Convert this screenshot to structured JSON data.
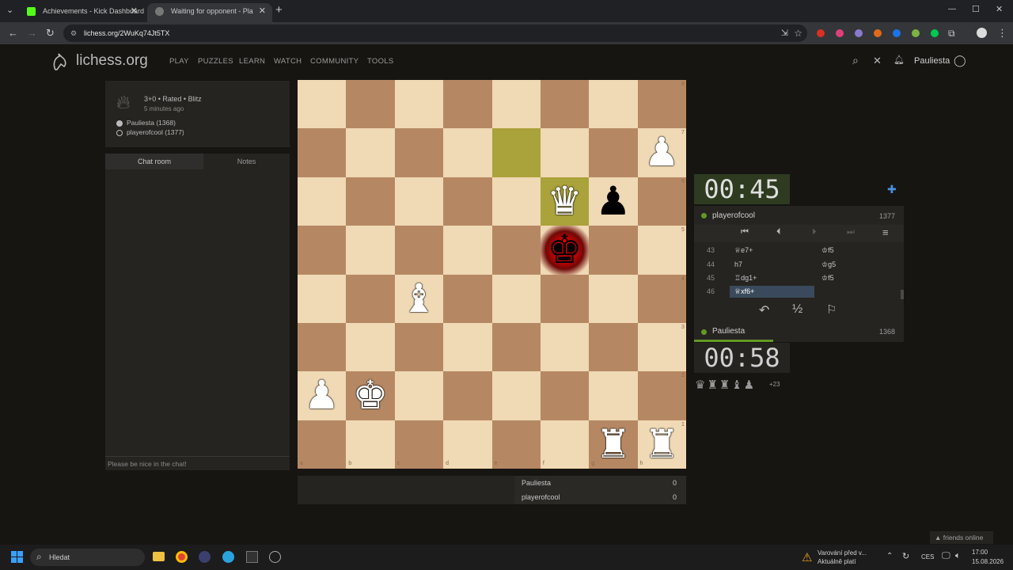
{
  "browser": {
    "tabs": [
      {
        "title": "Achievements - Kick Dashboard",
        "icon_color": "#53fc18",
        "active": false
      },
      {
        "title": "Waiting for opponent - Pla",
        "icon_color": "#888888",
        "active": true
      }
    ],
    "url": "lichess.org/2WuKq74Jt5TX",
    "icons": {
      "back": "←",
      "forward": "→",
      "reload": "↻",
      "new_tab": "+",
      "minimize": "—",
      "maximize": "☐",
      "close": "✕",
      "star": "☆",
      "menu": "⋮",
      "tab_close": "✕",
      "tab_menu": "⌄",
      "profile": "●",
      "extensions": "⧉"
    }
  },
  "site": {
    "logo_text": "lichess.org",
    "nav": [
      "PLAY",
      "PUZZLES",
      "LEARN",
      "WATCH",
      "COMMUNITY",
      "TOOLS"
    ],
    "username": "Pauliesta",
    "icons": {
      "search": "⌕",
      "close": "✕",
      "bell": "🔔︎",
      "user": "◯"
    }
  },
  "game": {
    "info": "3+0 • Rated • Blitz",
    "time_ago": "5 minutes ago",
    "white_player": "Pauliesta (1368)",
    "black_player": "playerofcool (1377)"
  },
  "chat": {
    "tab_chat": "Chat room",
    "tab_notes": "Notes",
    "placeholder": "Please be nice in the chat!"
  },
  "board": {
    "files": [
      "a",
      "b",
      "c",
      "d",
      "e",
      "f",
      "g",
      "h"
    ],
    "ranks": [
      "8",
      "7",
      "6",
      "5",
      "4",
      "3",
      "2",
      "1"
    ],
    "last_move": [
      "e7",
      "f6"
    ],
    "check": "f5",
    "pieces": [
      {
        "sq": "h7",
        "glyph": "♟",
        "color": "white"
      },
      {
        "sq": "f6",
        "glyph": "♛",
        "color": "white"
      },
      {
        "sq": "g6",
        "glyph": "♟",
        "color": "black"
      },
      {
        "sq": "f5",
        "glyph": "♚",
        "color": "black"
      },
      {
        "sq": "c4",
        "glyph": "♝",
        "color": "white"
      },
      {
        "sq": "a2",
        "glyph": "♟",
        "color": "white"
      },
      {
        "sq": "b2",
        "glyph": "♚",
        "color": "white"
      },
      {
        "sq": "g1",
        "glyph": "♜",
        "color": "white"
      },
      {
        "sq": "h1",
        "glyph": "♜",
        "color": "white"
      }
    ]
  },
  "score": {
    "p1": "Pauliesta",
    "s1": "0",
    "p2": "playerofcool",
    "s2": "0"
  },
  "clock": {
    "top": "00:45",
    "bottom": "00:58"
  },
  "opponent": {
    "name": "playerofcool",
    "rating": "1377"
  },
  "me": {
    "name": "Pauliesta",
    "rating": "1368"
  },
  "moves": [
    {
      "n": "43",
      "w": "♕e7+",
      "b": "♔f5"
    },
    {
      "n": "44",
      "w": "h7",
      "b": "♔g5"
    },
    {
      "n": "45",
      "w": "♖dg1+",
      "b": "♔f5"
    },
    {
      "n": "46",
      "w": "♕xf6+",
      "b": ""
    }
  ],
  "controls": {
    "first": "⏮",
    "prev": "⏴",
    "next": "⏵",
    "last": "⏭",
    "menu": "≡",
    "takeback": "↶",
    "draw": "½",
    "resign": "⚐",
    "plus": "✚"
  },
  "material": {
    "pieces": "♛♜♜♝♟",
    "diff": "+23"
  },
  "friends": "▲ friends online",
  "taskbar": {
    "search": "Hledat",
    "warning_line1": "Varování před v...",
    "warning_line2": "Aktuálně platí",
    "lang": "CES",
    "time": "17:00",
    "date": "15.08.2026"
  }
}
